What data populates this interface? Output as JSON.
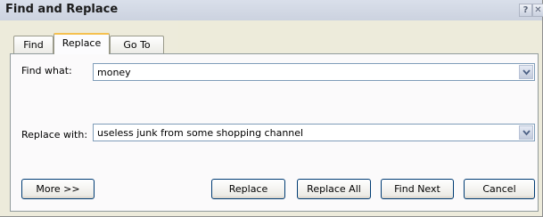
{
  "window": {
    "title": "Find and Replace",
    "help_label": "?",
    "close_label": "✕"
  },
  "tabs": [
    {
      "label": "Find",
      "active": false
    },
    {
      "label": "Replace",
      "active": true
    },
    {
      "label": "Go To",
      "active": false
    }
  ],
  "find": {
    "label": "Find what:",
    "value": "money"
  },
  "replace": {
    "label": "Replace with:",
    "value": "useless junk from some shopping channel"
  },
  "buttons": {
    "more": "More >>",
    "replace": "Replace",
    "replace_all": "Replace All",
    "find_next": "Find Next",
    "cancel": "Cancel"
  },
  "icons": {
    "dropdown": "chevron-down-icon"
  }
}
